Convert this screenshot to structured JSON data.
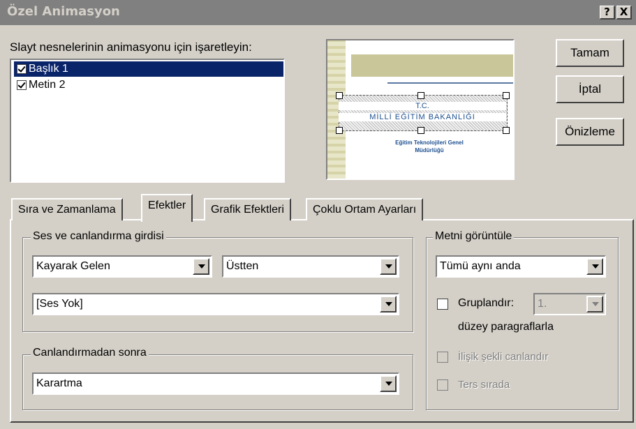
{
  "window": {
    "title": "Özel Animasyon",
    "help_btn": "?",
    "close_btn": "X"
  },
  "objects": {
    "prompt": "Slayt nesnelerinin animasyonu için işaretleyin:",
    "items": [
      {
        "label": "Başlık 1",
        "checked": true,
        "selected": true
      },
      {
        "label": "Metin 2",
        "checked": true,
        "selected": false
      }
    ]
  },
  "preview": {
    "line1": "T.C.",
    "line2": "MİLLİ EĞİTİM BAKANLIĞI",
    "line3": "Eğitim Teknolojileri Genel",
    "line4": "Müdürlüğü"
  },
  "buttons": {
    "ok": "Tamam",
    "cancel": "İptal",
    "preview": "Önizleme"
  },
  "tabs": [
    {
      "label": "Sıra ve Zamanlama",
      "active": false
    },
    {
      "label": "Efektler",
      "active": true
    },
    {
      "label": "Grafik Efektleri",
      "active": false
    },
    {
      "label": "Çoklu Ortam Ayarları",
      "active": false
    }
  ],
  "effects": {
    "group_sound_label": "Ses ve canlandırma girdisi",
    "effect_value": "Kayarak Gelen",
    "direction_value": "Üstten",
    "sound_value": "[Ses Yok]",
    "group_after_label": "Canlandırmadan sonra",
    "after_value": "Karartma"
  },
  "text": {
    "group_label": "Metni görüntüle",
    "display_value": "Tümü aynı anda",
    "group_check_label": "Gruplandır:",
    "group_level_value": "1.",
    "level_suffix": "düzey paragraflarla",
    "attached_label": "İlişik şekli canlandır",
    "reverse_label": "Ters sırada"
  },
  "colors": {
    "selection": "#0a246a",
    "titlebar": "#808080",
    "face": "#d4d0c8"
  }
}
